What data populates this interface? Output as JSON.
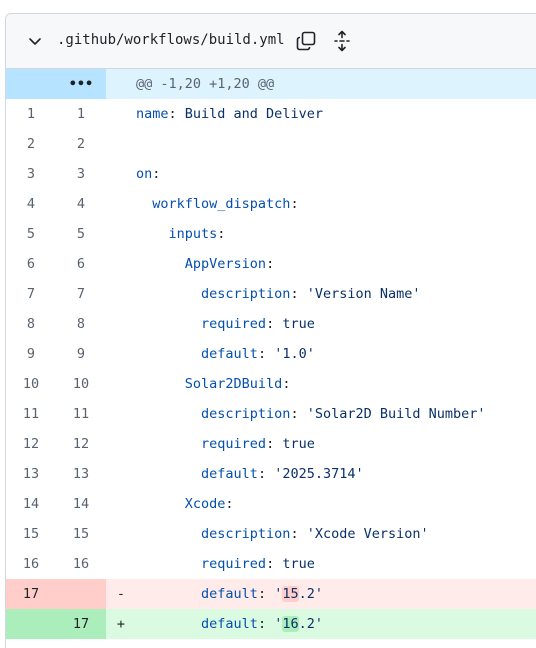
{
  "file": {
    "path": ".github/workflows/build.yml"
  },
  "icons": {
    "chevron": "chevron-down-icon",
    "copy": "copy-icon",
    "expand": "unfold-icon"
  },
  "hunk": {
    "expander": "•••",
    "header": "@@ -1,20 +1,20 @@"
  },
  "lines": [
    {
      "old": "1",
      "new": "1",
      "key": "name",
      "sep": ": ",
      "value": "Build and Deliver",
      "indent": 0
    },
    {
      "old": "2",
      "new": "2",
      "key": "",
      "sep": "",
      "value": "",
      "indent": 0
    },
    {
      "old": "3",
      "new": "3",
      "key": "on",
      "sep": ":",
      "value": "",
      "indent": 0
    },
    {
      "old": "4",
      "new": "4",
      "key": "workflow_dispatch",
      "sep": ":",
      "value": "",
      "indent": 2
    },
    {
      "old": "5",
      "new": "5",
      "key": "inputs",
      "sep": ":",
      "value": "",
      "indent": 4
    },
    {
      "old": "6",
      "new": "6",
      "key": "AppVersion",
      "sep": ":",
      "value": "",
      "indent": 6
    },
    {
      "old": "7",
      "new": "7",
      "key": "description",
      "sep": ": ",
      "value": "'Version Name'",
      "indent": 8
    },
    {
      "old": "8",
      "new": "8",
      "key": "required",
      "sep": ": ",
      "value": "true",
      "indent": 8
    },
    {
      "old": "9",
      "new": "9",
      "key": "default",
      "sep": ": ",
      "value": "'1.0'",
      "indent": 8
    },
    {
      "old": "10",
      "new": "10",
      "key": "Solar2DBuild",
      "sep": ":",
      "value": "",
      "indent": 6
    },
    {
      "old": "11",
      "new": "11",
      "key": "description",
      "sep": ": ",
      "value": "'Solar2D Build Number'",
      "indent": 8
    },
    {
      "old": "12",
      "new": "12",
      "key": "required",
      "sep": ": ",
      "value": "true",
      "indent": 8
    },
    {
      "old": "13",
      "new": "13",
      "key": "default",
      "sep": ": ",
      "value": "'2025.3714'",
      "indent": 8
    },
    {
      "old": "14",
      "new": "14",
      "key": "Xcode",
      "sep": ":",
      "value": "",
      "indent": 6
    },
    {
      "old": "15",
      "new": "15",
      "key": "description",
      "sep": ": ",
      "value": "'Xcode Version'",
      "indent": 8
    },
    {
      "old": "16",
      "new": "16",
      "key": "required",
      "sep": ": ",
      "value": "true",
      "indent": 8
    }
  ],
  "deleted": {
    "old": "17",
    "marker": "-",
    "key": "default",
    "sep": ": ",
    "pre": "'",
    "changed": "15",
    "post": ".2'"
  },
  "added": {
    "new": "17",
    "marker": "+",
    "key": "default",
    "sep": ": ",
    "pre": "'",
    "changed": "16",
    "post": ".2'"
  }
}
